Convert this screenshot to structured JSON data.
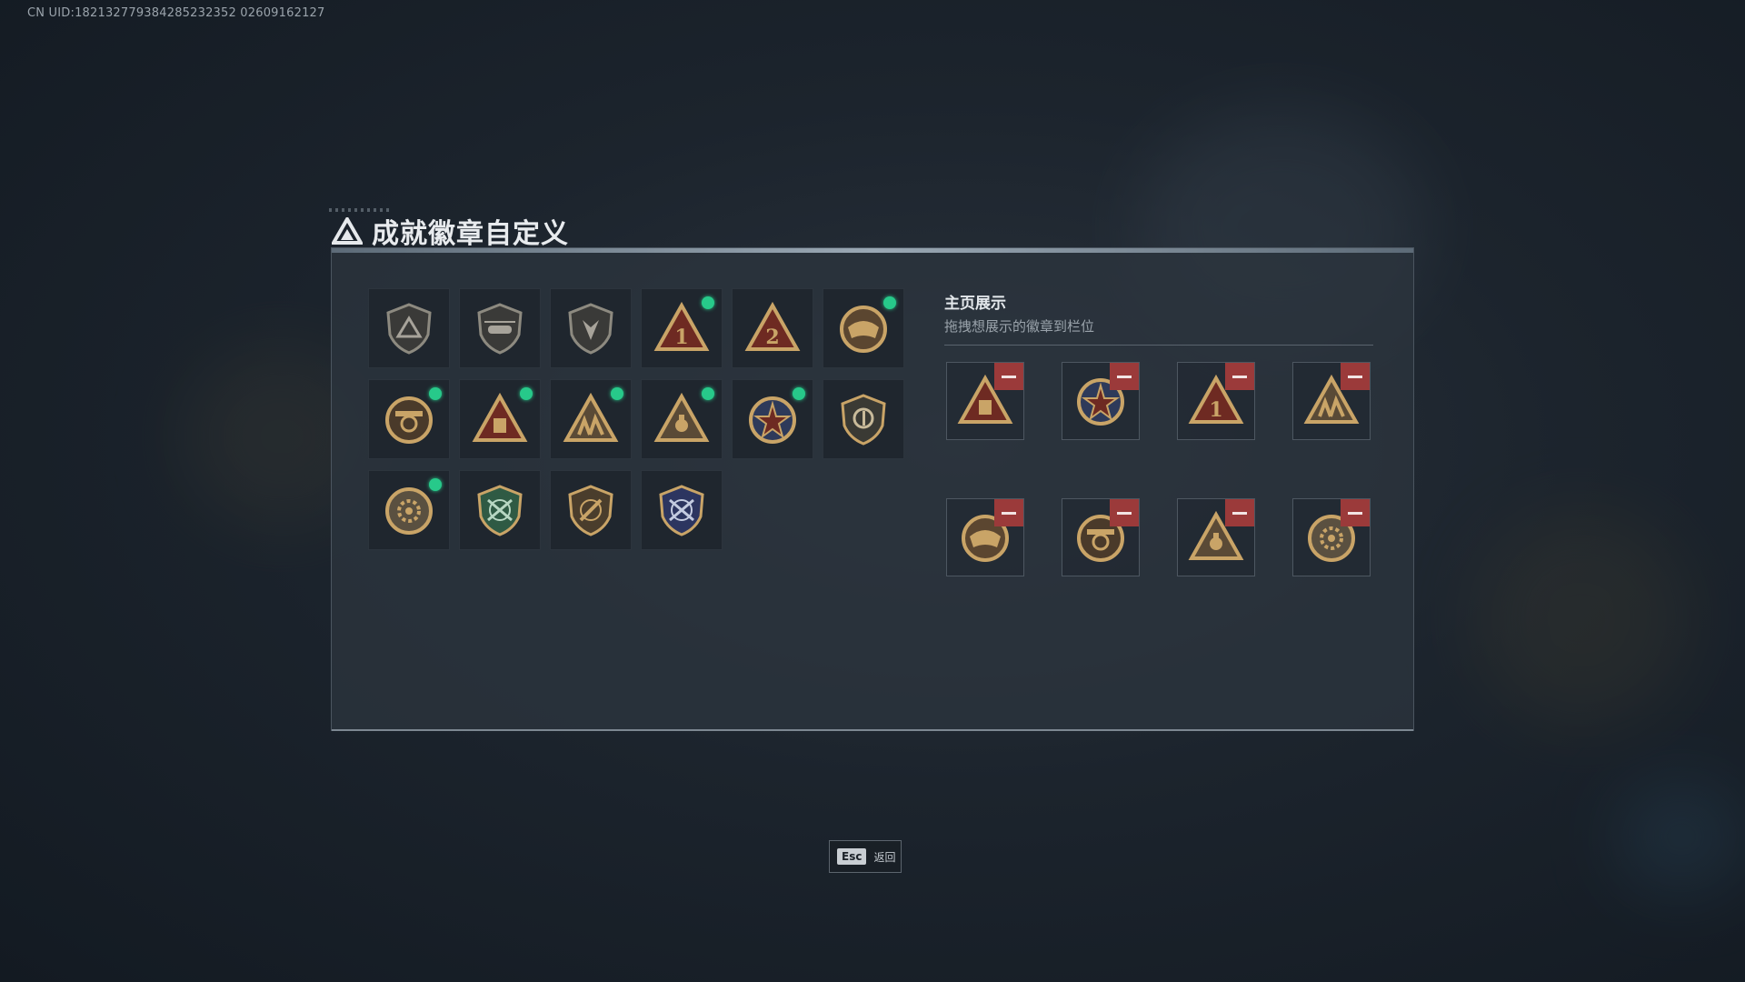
{
  "uid_text": "CN UID:182132779384285232352 02609162127",
  "title": "成就徽章自定义",
  "colors": {
    "accent_green": "#27c98a",
    "remove_red": "#9b3a3a",
    "gold": "#c9a467",
    "dark_red": "#6e2a22"
  },
  "badges": [
    {
      "icon": "shield-triangle-badge-icon",
      "new": false
    },
    {
      "icon": "shield-helicopter-badge-icon",
      "new": false
    },
    {
      "icon": "shield-arrow-badge-icon",
      "new": false
    },
    {
      "icon": "triangle-number-1-badge-icon",
      "new": true
    },
    {
      "icon": "triangle-number-2-badge-icon",
      "new": false
    },
    {
      "icon": "dragon-crest-badge-icon",
      "new": true
    },
    {
      "icon": "tiger-year-badge-icon",
      "new": true
    },
    {
      "icon": "triangle-box-badge-icon",
      "new": true
    },
    {
      "icon": "triangle-soldiers-badge-icon",
      "new": true
    },
    {
      "icon": "triangle-rescue-badge-icon",
      "new": true
    },
    {
      "icon": "star-compass-badge-icon",
      "new": true
    },
    {
      "icon": "shield-round-badge-icon",
      "new": false
    },
    {
      "icon": "gear-emblem-badge-icon",
      "new": true
    },
    {
      "icon": "green-rifles-badge-icon",
      "new": false
    },
    {
      "icon": "bronze-rifle-badge-icon",
      "new": false
    },
    {
      "icon": "blue-rifles-badge-icon",
      "new": false
    }
  ],
  "showcase": {
    "heading": "主页展示",
    "subtitle": "拖拽想展示的徽章到栏位",
    "slots": [
      {
        "icon": "triangle-box-badge-icon"
      },
      {
        "icon": "star-compass-badge-icon"
      },
      {
        "icon": "triangle-number-1-badge-icon"
      },
      {
        "icon": "triangle-soldiers-badge-icon"
      },
      {
        "icon": "dragon-crest-badge-icon"
      },
      {
        "icon": "tiger-year-badge-icon"
      },
      {
        "icon": "triangle-rescue-badge-icon"
      },
      {
        "icon": "gear-emblem-badge-icon"
      }
    ]
  },
  "esc": {
    "key": "Esc",
    "label": "返回"
  }
}
